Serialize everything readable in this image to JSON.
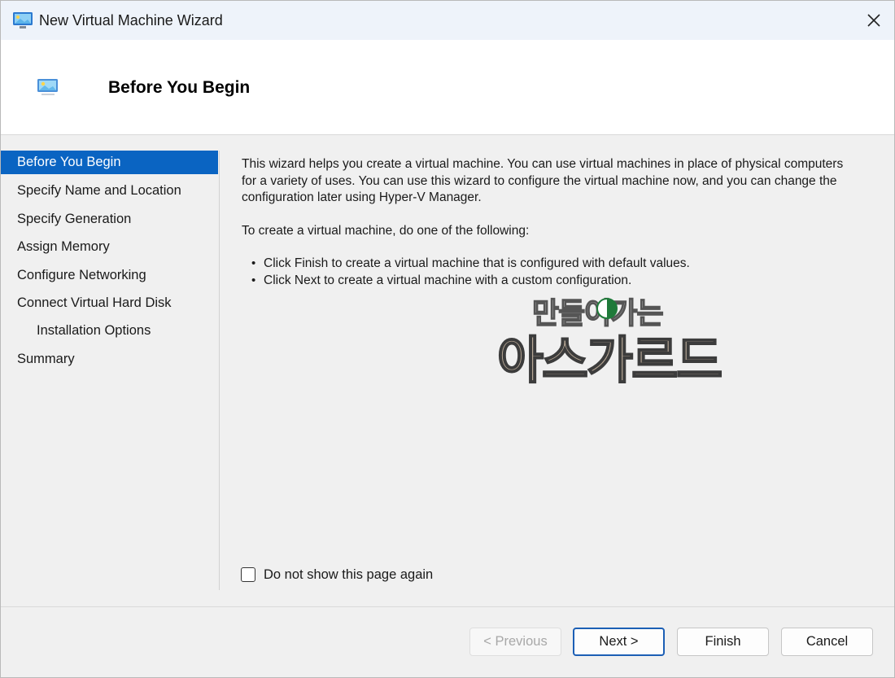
{
  "window": {
    "title": "New Virtual Machine Wizard",
    "close_label": "✕",
    "header_title": "Before You Begin"
  },
  "sidebar": {
    "items": [
      {
        "label": "Before You Begin",
        "selected": true
      },
      {
        "label": "Specify Name and Location"
      },
      {
        "label": "Specify Generation"
      },
      {
        "label": "Assign Memory"
      },
      {
        "label": "Configure Networking"
      },
      {
        "label": "Connect Virtual Hard Disk"
      },
      {
        "label": "Installation Options",
        "indent": true
      },
      {
        "label": "Summary"
      }
    ]
  },
  "content": {
    "paragraph1": "This wizard helps you create a virtual machine. You can use virtual machines in place of physical computers for a variety of uses. You can use this wizard to configure the virtual machine now, and you can change the configuration later using Hyper-V Manager.",
    "paragraph2": "To create a virtual machine, do one of the following:",
    "bullets": [
      "Click Finish to create a virtual machine that is configured with default values.",
      "Click Next to create a virtual machine with a custom configuration."
    ],
    "checkbox_label": "Do not show this page again",
    "checkbox_checked": false
  },
  "watermark": {
    "line1": "만들어가는",
    "line2": "아스가르드"
  },
  "buttons": {
    "previous": "< Previous",
    "next": "Next >",
    "finish": "Finish",
    "cancel": "Cancel"
  },
  "colors": {
    "selection": "#0a64c2",
    "titlebar": "#eef3fa",
    "default_button_border": "#1c5fb5"
  },
  "icons": {
    "title": "virtual-machine-icon",
    "header": "virtual-machine-icon",
    "close": "close-icon"
  }
}
